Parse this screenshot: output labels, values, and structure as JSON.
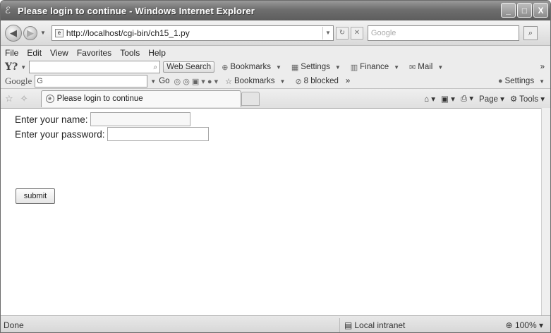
{
  "window": {
    "title": "Please login to continue - Windows Internet Explorer",
    "controls": [
      "_",
      "□",
      "X"
    ]
  },
  "address_bar": {
    "url": "http://localhost/cgi-bin/ch15_1.py",
    "search_placeholder": "Google"
  },
  "menu": [
    "File",
    "Edit",
    "View",
    "Favorites",
    "Tools",
    "Help"
  ],
  "yahoo_toolbar": {
    "logo": "Y?",
    "search_button": "Web Search",
    "items": [
      "Bookmarks",
      "Settings",
      "Finance",
      "Mail"
    ],
    "more": "»"
  },
  "google_toolbar": {
    "logo": "Google",
    "input": "G",
    "go": "Go",
    "bookmarks": "Bookmarks",
    "blocked": "8 blocked",
    "more": "»",
    "settings": "Settings"
  },
  "tab": {
    "label": "Please login to continue"
  },
  "command_bar": {
    "page": "Page",
    "tools": "Tools"
  },
  "form": {
    "name_label": "Enter your name:",
    "password_label": "Enter your password:",
    "submit_label": "submit"
  },
  "status": {
    "text": "Done",
    "zone": "Local intranet",
    "zoom": "100%"
  }
}
